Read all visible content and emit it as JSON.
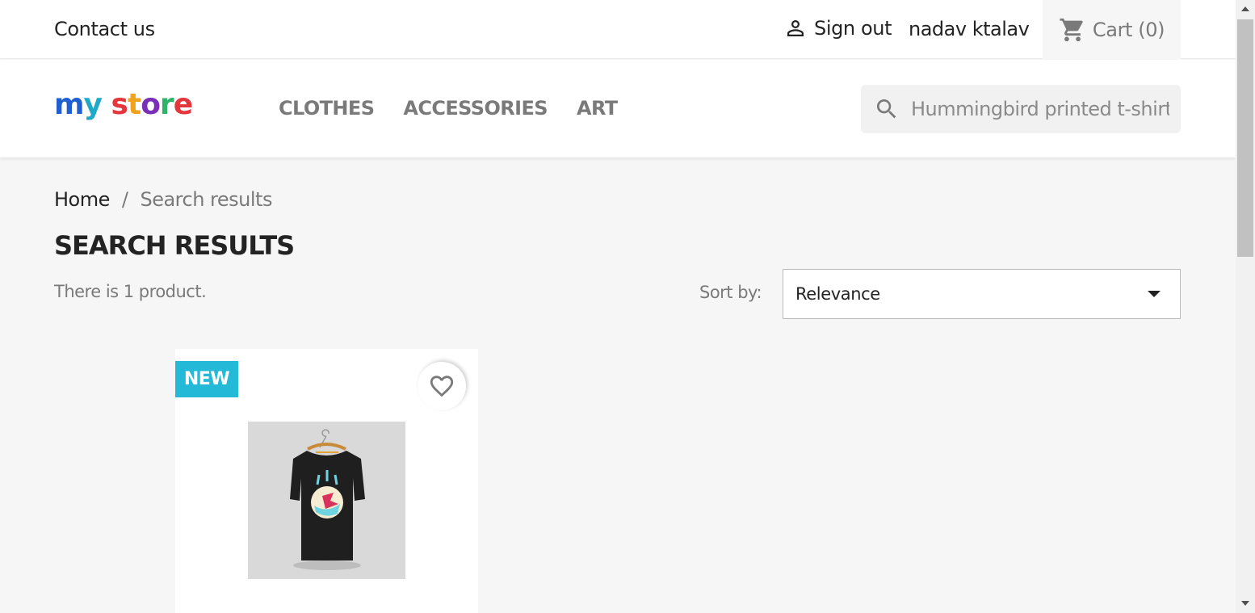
{
  "topbar": {
    "contact_label": "Contact us",
    "signout_label": "Sign out",
    "username": "nadav ktalav",
    "cart_label": "Cart (0)"
  },
  "header": {
    "logo_text": "my store",
    "nav": [
      "CLOTHES",
      "ACCESSORIES",
      "ART"
    ],
    "search": {
      "placeholder": "Hummingbird printed t-shirt",
      "value": ""
    }
  },
  "breadcrumb": {
    "home": "Home",
    "separator": "/",
    "current": "Search results"
  },
  "main": {
    "title": "SEARCH RESULTS",
    "count_text": "There is 1 product.",
    "sort_label": "Sort by:",
    "sort_value": "Relevance"
  },
  "products": [
    {
      "badge": "NEW",
      "image": "black t-shirt on hanger"
    }
  ],
  "colors": {
    "badge": "#24b9d7",
    "accent_text": "#7a7a7a",
    "text": "#232323"
  },
  "icons": {
    "user": "user-icon",
    "cart": "cart-icon",
    "search": "search-icon",
    "wishlist": "heart-icon",
    "sort": "caret-down-icon"
  }
}
